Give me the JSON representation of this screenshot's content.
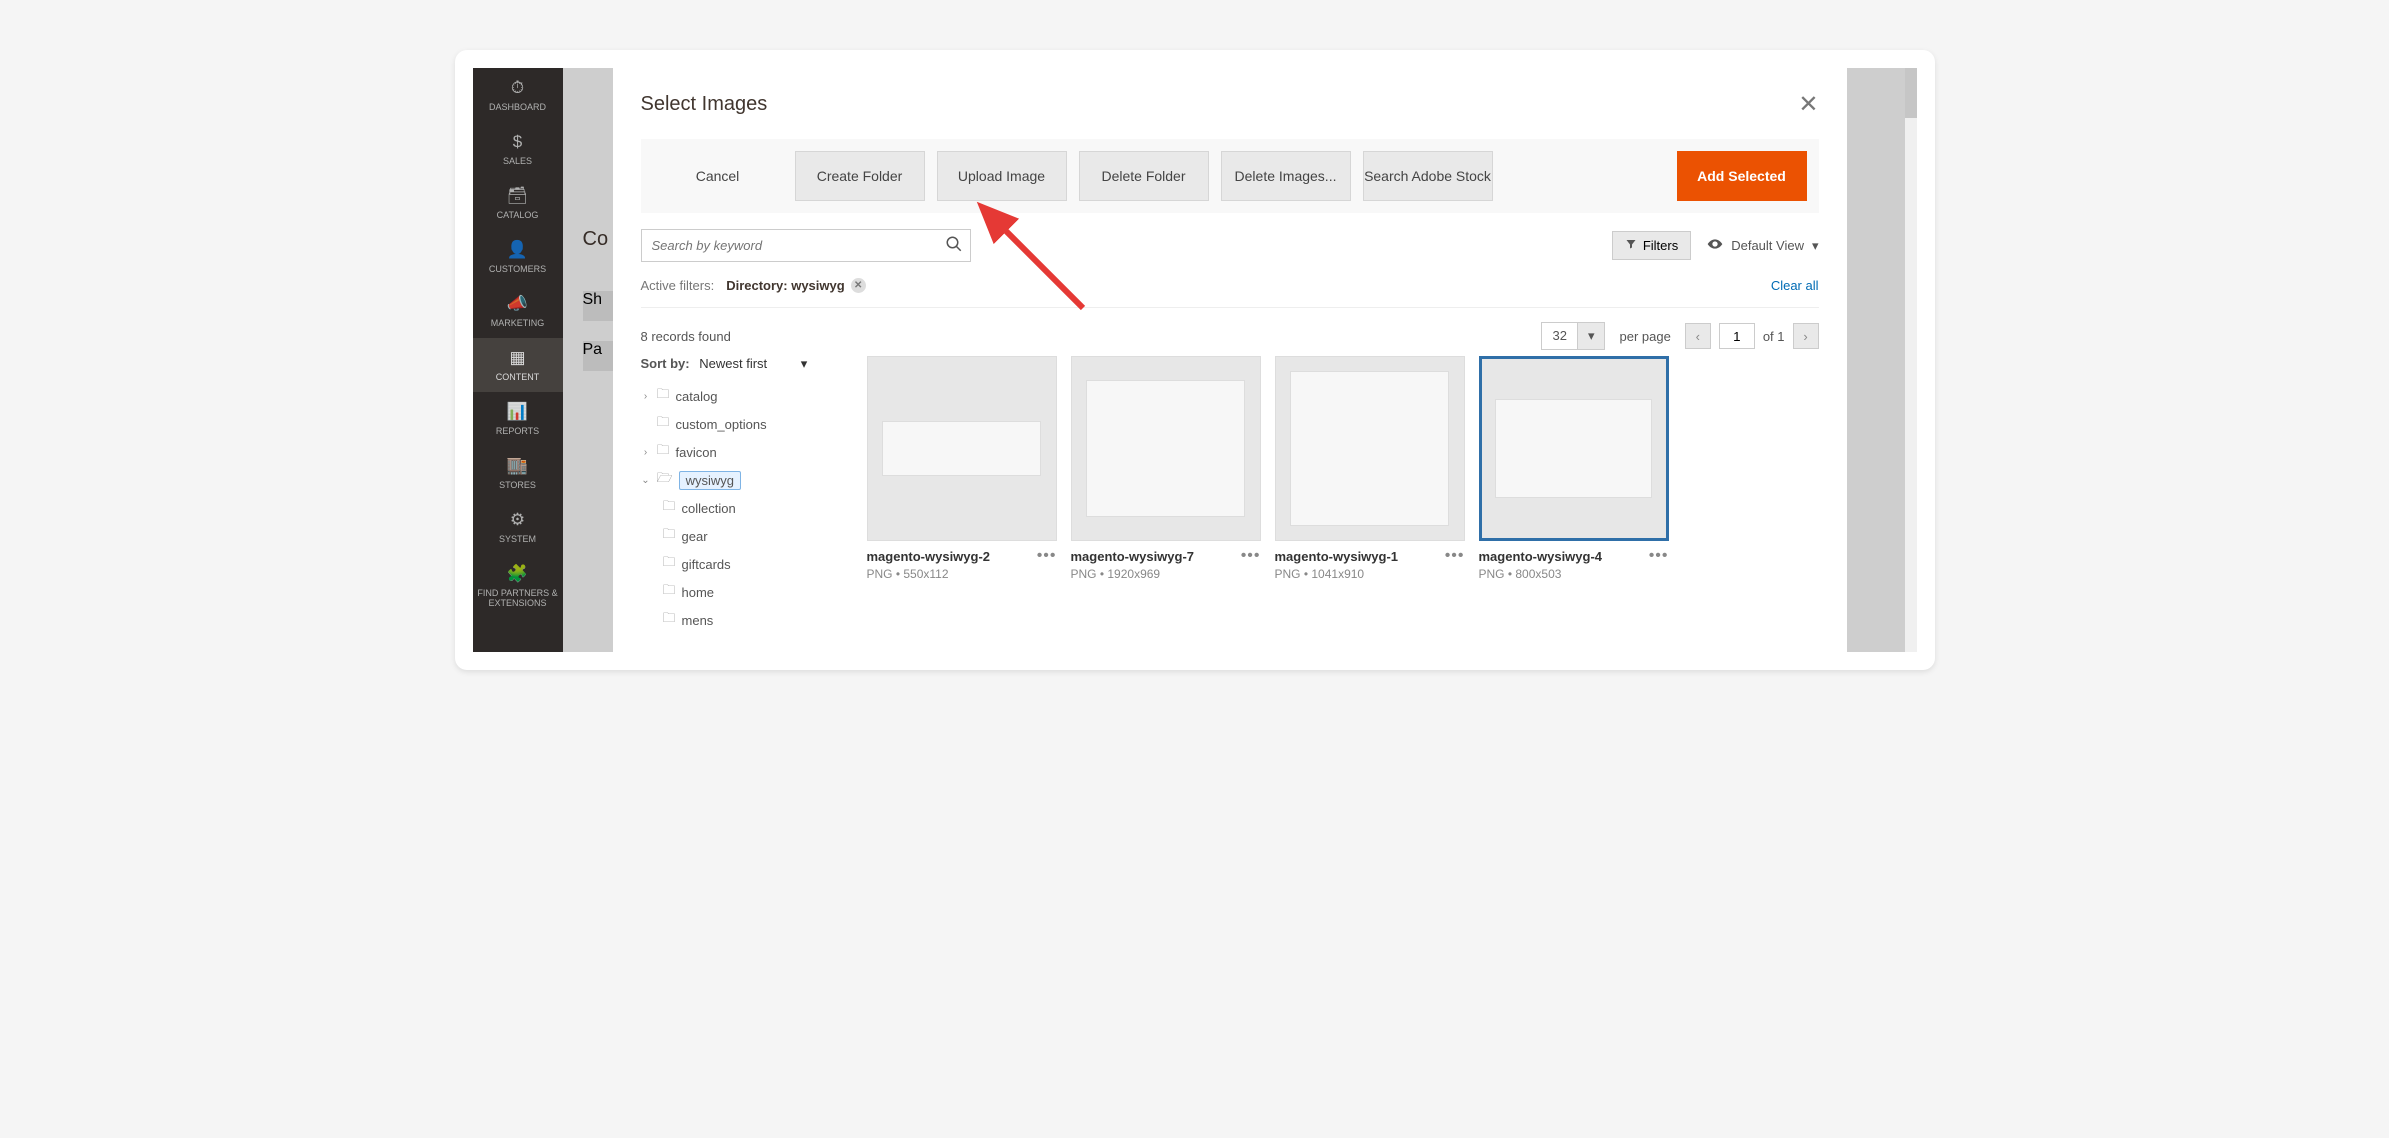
{
  "sidebar": {
    "items": [
      {
        "icon": "⏱",
        "label": "DASHBOARD"
      },
      {
        "icon": "$",
        "label": "SALES"
      },
      {
        "icon": "🗃",
        "label": "CATALOG"
      },
      {
        "icon": "👤",
        "label": "CUSTOMERS"
      },
      {
        "icon": "📣",
        "label": "MARKETING"
      },
      {
        "icon": "▦",
        "label": "CONTENT"
      },
      {
        "icon": "📊",
        "label": "REPORTS"
      },
      {
        "icon": "🏬",
        "label": "STORES"
      },
      {
        "icon": "⚙",
        "label": "SYSTEM"
      },
      {
        "icon": "🧩",
        "label": "FIND PARTNERS & EXTENSIONS"
      }
    ]
  },
  "bg": {
    "heading": "Co",
    "row1": "Sh",
    "row2": "Pa"
  },
  "modal": {
    "title": "Select Images",
    "toolbar": {
      "cancel": "Cancel",
      "create_folder": "Create Folder",
      "upload_image": "Upload Image",
      "delete_folder": "Delete Folder",
      "delete_images": "Delete Images...",
      "search_stock": "Search Adobe Stock",
      "add_selected": "Add Selected"
    },
    "search_placeholder": "Search by keyword",
    "filters_button": "Filters",
    "default_view": "Default View",
    "active_filters_label": "Active filters:",
    "active_filter_chip": "Directory: wysiwyg",
    "clear_all": "Clear all",
    "records_found": "8 records found",
    "per_page_value": "32",
    "per_page_label": "per page",
    "page_value": "1",
    "page_of": "of 1",
    "sort_label": "Sort by:",
    "sort_value": "Newest first",
    "tree": {
      "catalog": "catalog",
      "custom_options": "custom_options",
      "favicon": "favicon",
      "wysiwyg": "wysiwyg",
      "collection": "collection",
      "gear": "gear",
      "giftcards": "giftcards",
      "home": "home",
      "mens": "mens"
    },
    "thumbs": [
      {
        "name": "magento-wysiwyg-2",
        "meta": "PNG • 550x112"
      },
      {
        "name": "magento-wysiwyg-7",
        "meta": "PNG • 1920x969"
      },
      {
        "name": "magento-wysiwyg-1",
        "meta": "PNG • 1041x910"
      },
      {
        "name": "magento-wysiwyg-4",
        "meta": "PNG • 800x503"
      }
    ]
  }
}
